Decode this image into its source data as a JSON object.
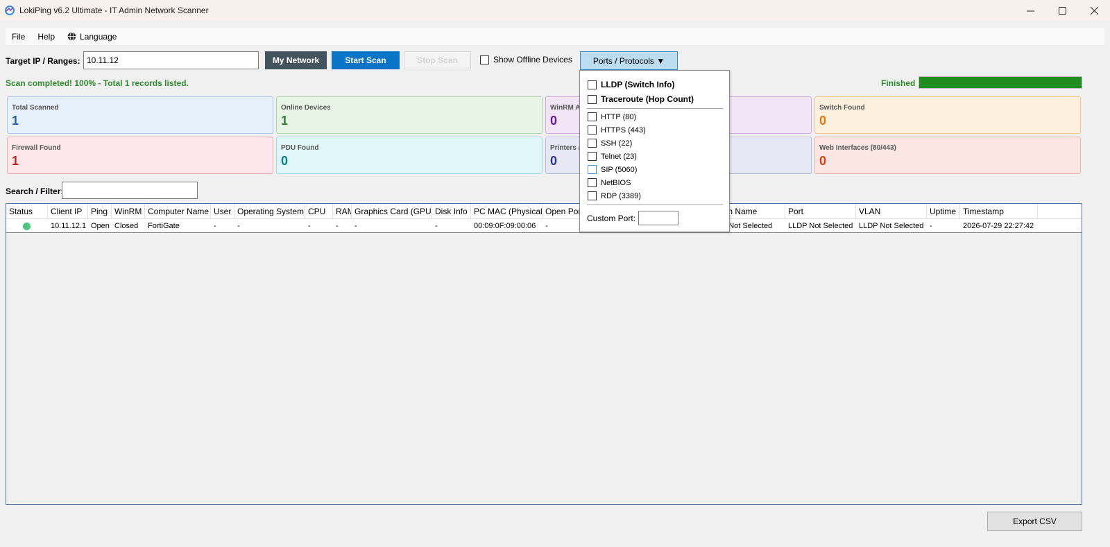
{
  "window": {
    "title": "LokiPing v6.2 Ultimate - IT Admin Network Scanner"
  },
  "menu": {
    "file": "File",
    "help": "Help",
    "language": "Language"
  },
  "toolbar": {
    "target_label": "Target IP / Ranges:",
    "target_value": "10.11.12",
    "my_network": "My Network",
    "start_scan": "Start Scan",
    "stop_scan": "Stop Scan",
    "show_offline": "Show Offline Devices",
    "show_offline_checked": false,
    "ports_button": "Ports / Protocols ▼"
  },
  "status": {
    "message": "Scan completed! 100% - Total 1 records listed.",
    "state": "Finished",
    "progress_percent": 100
  },
  "cards": [
    {
      "label": "Total Scanned",
      "value": "1",
      "bg": "#e6f1fb",
      "border": "#a7c9ee",
      "color": "#1f5fb0"
    },
    {
      "label": "Online Devices",
      "value": "1",
      "bg": "#e7f4e6",
      "border": "#a9d6a4",
      "color": "#2e7d32"
    },
    {
      "label": "WinRM A",
      "value": "0",
      "bg": "#f1e5f6",
      "border": "#d1a9e0",
      "color": "#6a1b9a"
    },
    {
      "label": "Switch Found",
      "value": "0",
      "bg": "#fdf0de",
      "border": "#f2c98a",
      "color": "#e07a10"
    },
    {
      "label": "Firewall Found",
      "value": "1",
      "bg": "#fde7eb",
      "border": "#f0a9b4",
      "color": "#c62828"
    },
    {
      "label": "PDU Found",
      "value": "0",
      "bg": "#e0f6f8",
      "border": "#9fdbe2",
      "color": "#00838f"
    },
    {
      "label": "Printers /",
      "value": "0",
      "bg": "#e8e8f5",
      "border": "#b7b9e0",
      "color": "#283593"
    },
    {
      "label": "Web Interfaces (80/443)",
      "value": "0",
      "bg": "#fbe6e3",
      "border": "#efb1a8",
      "color": "#d84315"
    }
  ],
  "search": {
    "label": "Search / Filter:",
    "value": ""
  },
  "table": {
    "headers": [
      "Status",
      "Client IP",
      "Ping",
      "WinRM",
      "Computer Name",
      "User",
      "Operating System",
      "CPU",
      "RAM",
      "Graphics Card (GPU)",
      "Disk Info",
      "PC MAC (Physical)",
      "Open Por",
      "tch Name",
      "Port",
      "VLAN",
      "Uptime",
      "Timestamp"
    ],
    "rows": [
      [
        "",
        "10.11.12.1",
        "Open",
        "Closed",
        "FortiGate",
        "-",
        "-",
        "-",
        "-",
        "-",
        "-",
        "00:09:0F:09:00:06",
        "-",
        "P Not Selected",
        "LLDP Not Selected",
        "LLDP Not Selected",
        "-",
        "2026-07-29 22:27:42"
      ]
    ]
  },
  "dropdown": {
    "items": [
      {
        "label": "LLDP (Switch Info)",
        "checked": false,
        "bold": true
      },
      {
        "label": "Traceroute (Hop Count)",
        "checked": false,
        "bold": true
      },
      {
        "label": "HTTP (80)",
        "checked": false
      },
      {
        "label": "HTTPS (443)",
        "checked": false
      },
      {
        "label": "SSH (22)",
        "checked": false
      },
      {
        "label": "Telnet (23)",
        "checked": false
      },
      {
        "label": "SIP (5060)",
        "checked": false
      },
      {
        "label": "NetBIOS",
        "checked": false
      },
      {
        "label": "RDP (3389)",
        "checked": false
      }
    ],
    "custom_port_label": "Custom Port:",
    "custom_port_value": ""
  },
  "footer": {
    "export": "Export CSV"
  },
  "icons": {
    "app": "app-logo-icon",
    "language": "globe-icon"
  }
}
